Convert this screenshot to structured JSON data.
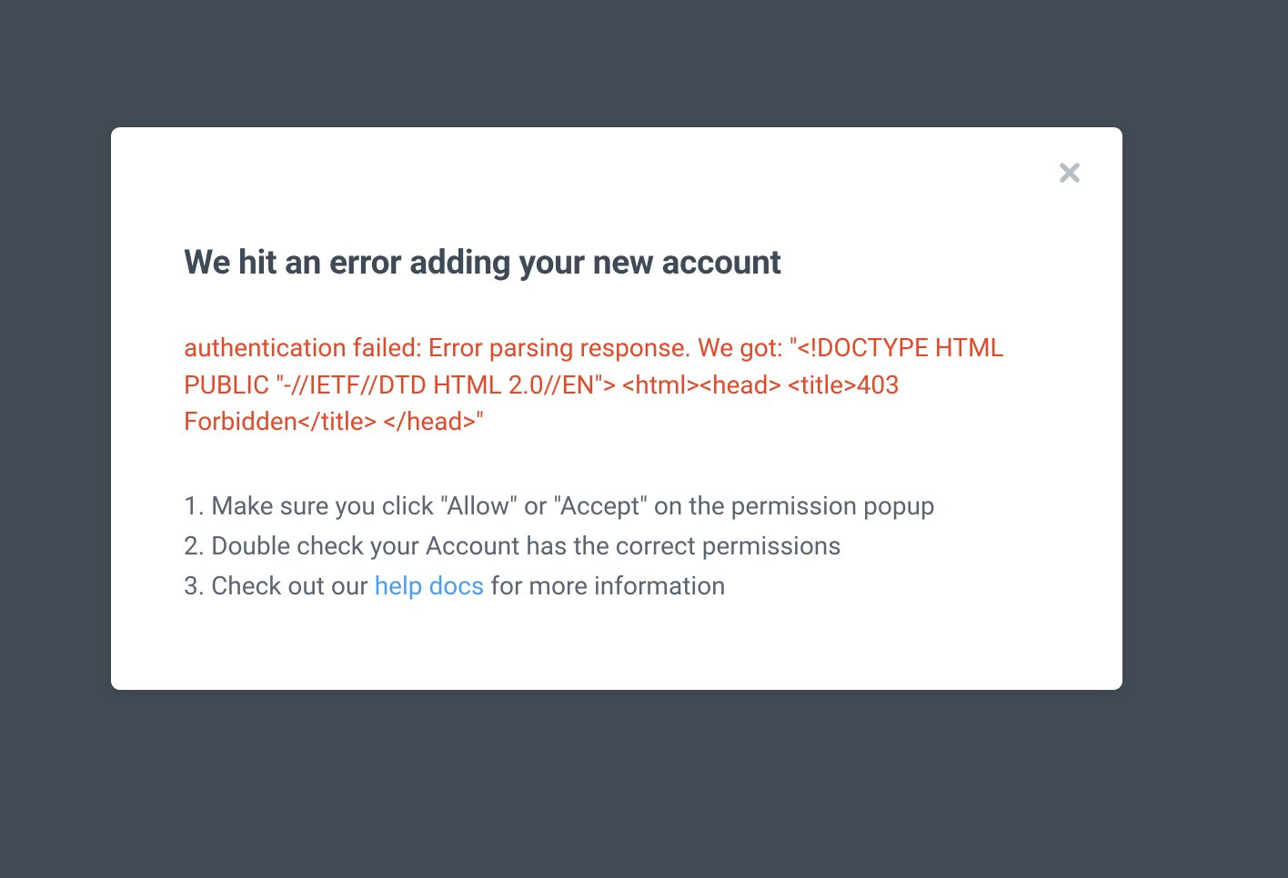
{
  "modal": {
    "title": "We hit an error adding your new account",
    "error_message": "authentication failed: Error parsing response. We got: \"<!DOCTYPE HTML PUBLIC \"-//IETF//DTD HTML 2.0//EN\"> <html><head> <title>403 Forbidden</title> </head>\"",
    "steps": {
      "step1": "Make sure you click \"Allow\" or \"Accept\" on the permission popup",
      "step2": "Double check your Account has the correct permissions",
      "step3_prefix": "Check out our ",
      "step3_link": "help docs",
      "step3_suffix": " for more information"
    }
  }
}
